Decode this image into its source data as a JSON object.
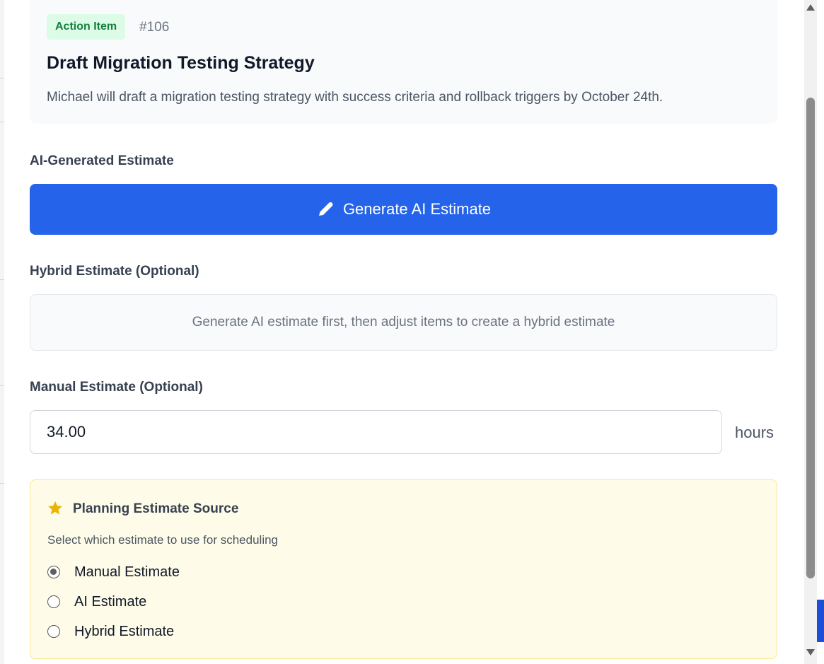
{
  "header": {
    "badge": "Action Item",
    "id": "#106",
    "title": "Draft Migration Testing Strategy",
    "description": "Michael will draft a migration testing strategy with success criteria and rollback triggers by October 24th."
  },
  "ai_section": {
    "label": "AI-Generated Estimate",
    "button_label": "Generate AI Estimate",
    "button_icon": "pencil-icon"
  },
  "hybrid_section": {
    "label": "Hybrid Estimate (Optional)",
    "placeholder": "Generate AI estimate first, then adjust items to create a hybrid estimate"
  },
  "manual_section": {
    "label": "Manual Estimate (Optional)",
    "value": "34.00",
    "unit": "hours"
  },
  "planning": {
    "icon": "star-icon",
    "title": "Planning Estimate Source",
    "subtitle": "Select which estimate to use for scheduling",
    "options": [
      {
        "label": "Manual Estimate",
        "checked": true
      },
      {
        "label": "AI Estimate",
        "checked": false
      },
      {
        "label": "Hybrid Estimate",
        "checked": false
      }
    ]
  },
  "colors": {
    "primary": "#2563eb",
    "badge_bg": "#dcfce7",
    "badge_text": "#15803d",
    "planning_bg": "#fefce8",
    "star": "#eab308"
  }
}
